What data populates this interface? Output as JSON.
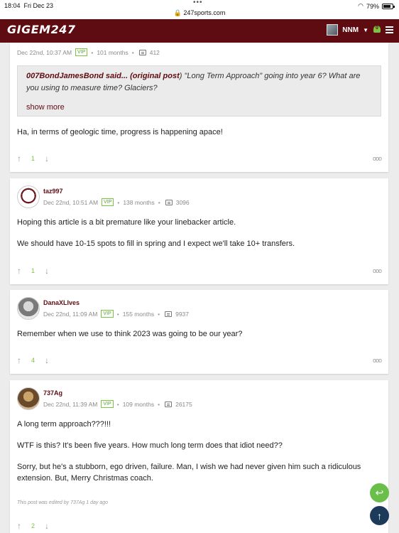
{
  "statusbar": {
    "time": "18:04",
    "date": "Fri Dec 23",
    "url": "247sports.com",
    "battery": "79%"
  },
  "header": {
    "logo_a": "GIGEM",
    "logo_b": "247",
    "username": "NNM",
    "notif_count": "0"
  },
  "posts": [
    {
      "author": "",
      "timestamp": "Dec 22nd, 10:37 AM",
      "vip": "VIP",
      "tenure": "101 months",
      "post_count": "412",
      "quote_author": "007BondJamesBond said... (original post",
      "quote_text": ") \"Long Term Approach\" going into year 6? What are you using to measure time? Glaciers?",
      "quote_more": "show more",
      "body": [
        "Ha, in terms of geologic time, progress is happening apace!"
      ],
      "upvotes": "1"
    },
    {
      "author": "taz997",
      "timestamp": "Dec 22nd, 10:51 AM",
      "vip": "VIP",
      "tenure": "138 months",
      "post_count": "3096",
      "body": [
        "Hoping this article is a bit premature like your linebacker article.",
        "We should have 10-15 spots to fill in spring and I expect we'll take 10+ transfers."
      ],
      "upvotes": "1"
    },
    {
      "author": "DanaXLIves",
      "timestamp": "Dec 22nd, 11:09 AM",
      "vip": "VIP",
      "tenure": "155 months",
      "post_count": "9937",
      "body": [
        "Remember when we use to think 2023 was going to be our year?"
      ],
      "upvotes": "4"
    },
    {
      "author": "737Ag",
      "timestamp": "Dec 22nd, 11:39 AM",
      "vip": "VIP",
      "tenure": "109 months",
      "post_count": "26175",
      "body": [
        "A long term approach???!!!",
        "WTF is this? It's been five years. How much long term does that idiot need??",
        "Sorry, but he's a stubborn, ego driven, failure. Man, I wish we had never given him such a ridiculous extension. But, Merry Christmas coach."
      ],
      "edit_note": "This post was edited by 737Ag 1 day ago",
      "upvotes": "2"
    }
  ],
  "ui": {
    "more": "ooo",
    "bullet": "•",
    "up": "↑",
    "down": "↓"
  },
  "colors": {
    "brand": "#5e0c12",
    "vip_green": "#7dc242",
    "fab_reply": "#6abf4b",
    "fab_top": "#1e3a5a"
  }
}
